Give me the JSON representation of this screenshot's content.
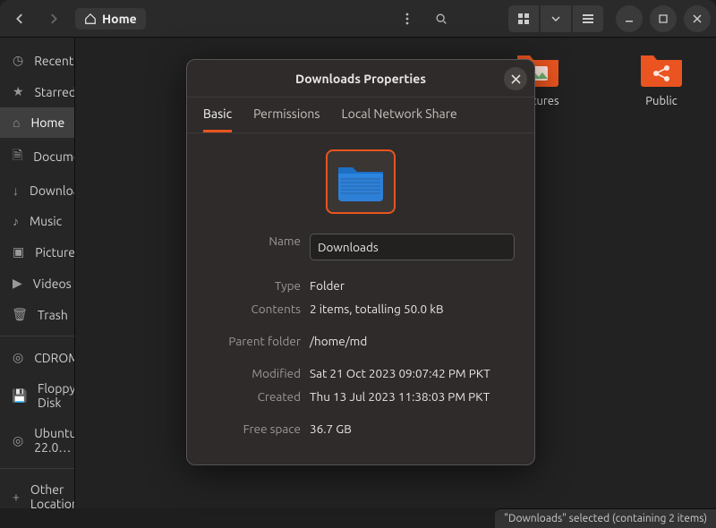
{
  "path_bar": {
    "label": "Home"
  },
  "sidebar": {
    "groups": [
      {
        "rows": [
          {
            "icon": "clock",
            "label": "Recent"
          },
          {
            "icon": "star",
            "label": "Starred"
          },
          {
            "icon": "home",
            "label": "Home",
            "active": true
          },
          {
            "icon": "doc",
            "label": "Documents"
          },
          {
            "icon": "down",
            "label": "Downloads"
          },
          {
            "icon": "music",
            "label": "Music"
          },
          {
            "icon": "image",
            "label": "Pictures"
          },
          {
            "icon": "video",
            "label": "Videos"
          },
          {
            "icon": "trash",
            "label": "Trash"
          }
        ]
      },
      {
        "rows": [
          {
            "icon": "disc",
            "label": "CDROM",
            "eject": true
          },
          {
            "icon": "floppy",
            "label": "Floppy Disk"
          },
          {
            "icon": "disc",
            "label": "Ubuntu 22.0…",
            "eject": true
          }
        ]
      }
    ],
    "other_locations": "Other Locations"
  },
  "folders": {
    "pictures": {
      "label": "Pictures",
      "color": "#e95420"
    },
    "public": {
      "label": "Public",
      "color": "#e95420"
    }
  },
  "modal": {
    "title": "Downloads Properties",
    "tabs": {
      "basic": "Basic",
      "permissions": "Permissions",
      "lns": "Local Network Share"
    },
    "labels": {
      "name": "Name",
      "type": "Type",
      "contents": "Contents",
      "parent": "Parent folder",
      "modified": "Modified",
      "created": "Created",
      "free": "Free space"
    },
    "values": {
      "name": "Downloads",
      "type": "Folder",
      "contents": "2 items, totalling 50.0 kB",
      "parent": "/home/md",
      "modified": "Sat 21 Oct 2023 09:07:42 PM PKT",
      "created": "Thu 13 Jul 2023 11:38:03 PM PKT",
      "free": "36.7 GB"
    }
  },
  "status_bar": "\"Downloads\" selected  (containing 2 items)"
}
